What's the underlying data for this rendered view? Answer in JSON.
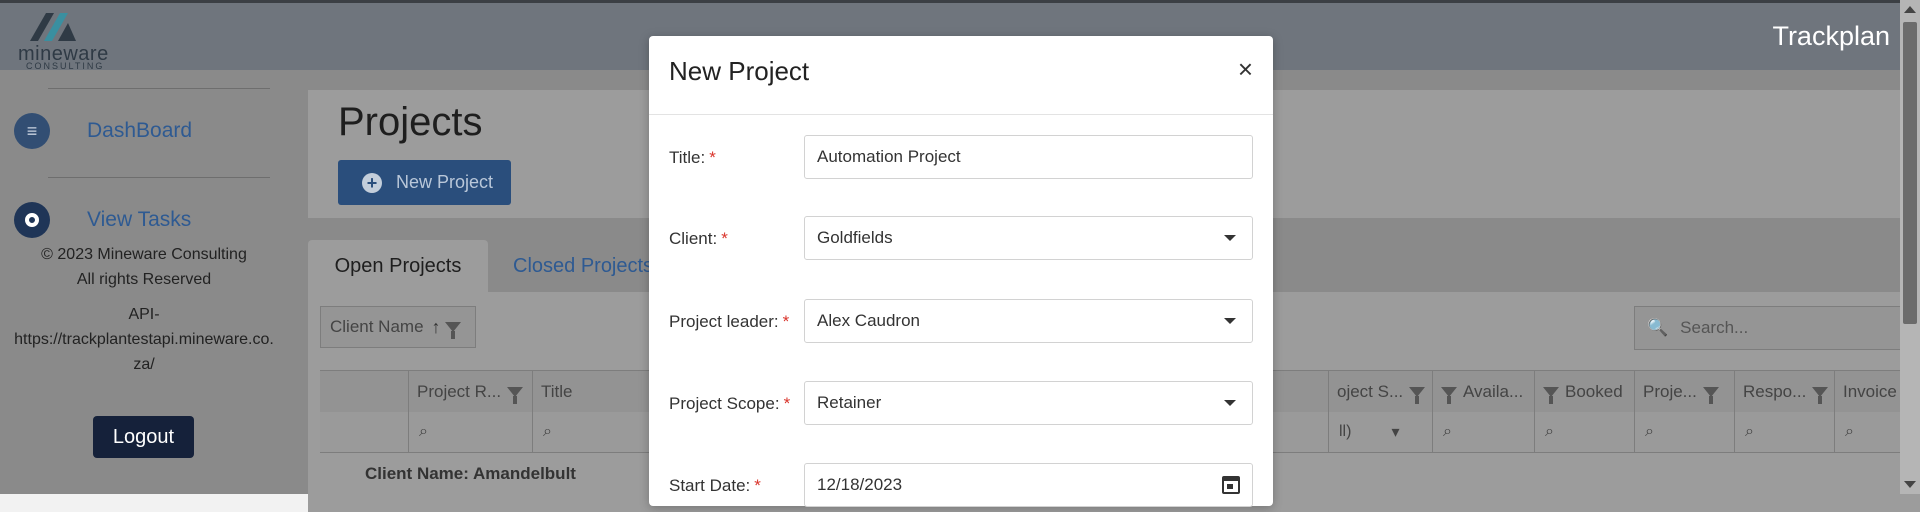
{
  "header": {
    "logo_text": "mineware",
    "logo_subtext": "CONSULTING",
    "app_title": "Trackplan"
  },
  "sidebar": {
    "items": [
      {
        "label": "DashBoard",
        "icon": "menu-icon"
      },
      {
        "label": "View Tasks",
        "icon": "target-icon"
      }
    ],
    "footer_lines": [
      "© 2023 Mineware Consulting",
      "All rights Reserved",
      "API-",
      "https://trackplantestapi.mineware.co.",
      "za/"
    ],
    "logout_label": "Logout"
  },
  "page": {
    "title": "Projects",
    "new_project_label": "New Project",
    "tabs": [
      {
        "label": "Open Projects",
        "active": true
      },
      {
        "label": "Closed Projects",
        "active": false
      }
    ],
    "group_by_label": "Client Name",
    "search_placeholder": "Search...",
    "columns": [
      {
        "label": "Project R..."
      },
      {
        "label": "Title"
      },
      {
        "label": "oject S..."
      },
      {
        "label": "Availa..."
      },
      {
        "label": "Booked"
      },
      {
        "label": "Proje..."
      },
      {
        "label": "Respo..."
      },
      {
        "label": "Invoice D..."
      }
    ],
    "filter_select_value": "ll)",
    "group_row_label": "Client Name: Amandelbult"
  },
  "modal": {
    "title": "New Project",
    "close_label": "×",
    "fields": [
      {
        "label": "Title:",
        "value": "Automation Project",
        "type": "text"
      },
      {
        "label": "Client:",
        "value": "Goldfields",
        "type": "select"
      },
      {
        "label": "Project leader:",
        "value": "Alex Caudron",
        "type": "select"
      },
      {
        "label": "Project Scope:",
        "value": "Retainer",
        "type": "select"
      },
      {
        "label": "Start Date:",
        "value": "12/18/2023",
        "type": "date"
      }
    ],
    "required_marker": "*"
  },
  "colors": {
    "accent": "#2a4e7c",
    "required": "#d9342b",
    "link": "#2e5a92"
  }
}
